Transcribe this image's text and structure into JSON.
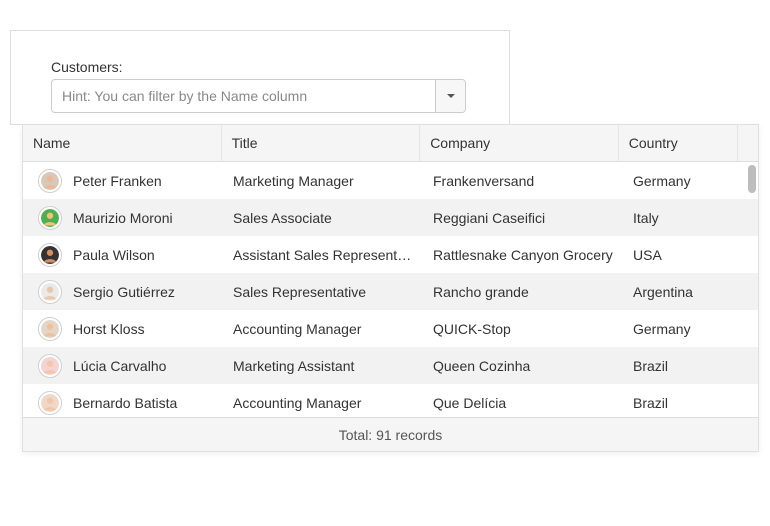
{
  "field": {
    "label": "Customers:",
    "placeholder": "Hint: You can filter by the Name column"
  },
  "grid": {
    "columns": {
      "name": "Name",
      "title": "Title",
      "company": "Company",
      "country": "Country"
    },
    "rows": [
      {
        "name": "Peter Franken",
        "title": "Marketing Manager",
        "company": "Frankenversand",
        "country": "Germany",
        "avatar_bg": "#d9c7b8",
        "avatar_skin": "#e9b89a"
      },
      {
        "name": "Maurizio Moroni",
        "title": "Sales Associate",
        "company": "Reggiani Caseifici",
        "country": "Italy",
        "avatar_bg": "#4caf50",
        "avatar_skin": "#f1c27d"
      },
      {
        "name": "Paula Wilson",
        "title": "Assistant Sales Represent…",
        "company": "Rattlesnake Canyon Grocery",
        "country": "USA",
        "avatar_bg": "#333333",
        "avatar_skin": "#d58f64"
      },
      {
        "name": "Sergio Gutiérrez",
        "title": "Sales Representative",
        "company": "Rancho grande",
        "country": "Argentina",
        "avatar_bg": "#eaeaea",
        "avatar_skin": "#e9c7a9"
      },
      {
        "name": "Horst Kloss",
        "title": "Accounting Manager",
        "company": "QUICK-Stop",
        "country": "Germany",
        "avatar_bg": "#e2d6c9",
        "avatar_skin": "#ecc19c"
      },
      {
        "name": "Lúcia Carvalho",
        "title": "Marketing Assistant",
        "company": "Queen Cozinha",
        "country": "Brazil",
        "avatar_bg": "#f5d3d0",
        "avatar_skin": "#f1c6aa"
      },
      {
        "name": "Bernardo Batista",
        "title": "Accounting Manager",
        "company": "Que Delícia",
        "country": "Brazil",
        "avatar_bg": "#f0d8c8",
        "avatar_skin": "#f1c6aa"
      }
    ],
    "footer_prefix": "Total: ",
    "footer_count": "91",
    "footer_suffix": " records"
  }
}
